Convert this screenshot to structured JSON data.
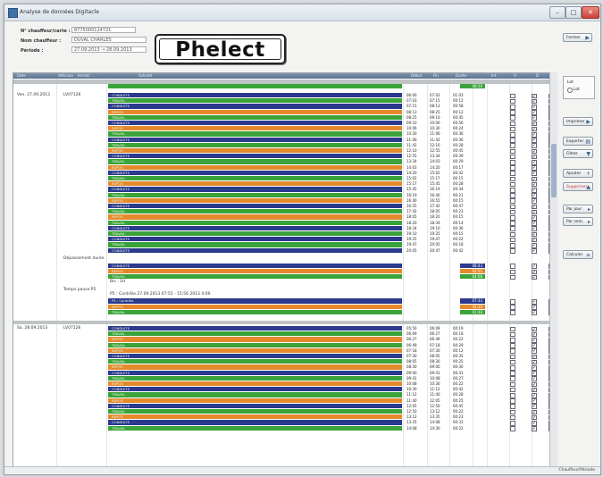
{
  "window": {
    "title": "Analyse de données Digitacle"
  },
  "header": {
    "fields": [
      {
        "label": "N° chauffeur/carte :",
        "value": "8775000124721"
      },
      {
        "label": "Nom chauffeur :",
        "value": "DUVAL CHARLES"
      },
      {
        "label": "Période :",
        "value": "27.09.2013  →  28.09.2013"
      }
    ],
    "logo_text": "Phelect",
    "top_right_button": "Fermer"
  },
  "grid": {
    "columns": [
      "Date",
      "Véhicule",
      "Immat.",
      "Activité",
      "Début",
      "Fin",
      "Durée",
      "Inf.",
      "V",
      "D"
    ],
    "summary_value": "08:50",
    "groups": [
      {
        "date": "Ven. 27.09.2013",
        "vehicle": "LV07126"
      },
      {
        "date": "Sa. 28.09.2013",
        "vehicle": "LV07126"
      }
    ],
    "section_labels": {
      "repos": "Dépassement durée",
      "pause": "Temps pause P5",
      "repos_total": "Bis : 1H",
      "comment": "P5 : Contrôle 27.09.2013 07:55 - 15:56 2013 4:00"
    },
    "rows_a": [
      {
        "act": "CONDUITE",
        "c": "navy",
        "s": "06:00",
        "e": "07:03",
        "d": "01:03"
      },
      {
        "act": "TRAVAIL",
        "c": "green",
        "s": "07:03",
        "e": "07:15",
        "d": "00:12"
      },
      {
        "act": "CONDUITE",
        "c": "navy",
        "s": "07:15",
        "e": "08:13",
        "d": "00:58"
      },
      {
        "act": "REPOS",
        "c": "orange",
        "s": "08:13",
        "e": "08:25",
        "d": "00:12"
      },
      {
        "act": "TRAVAIL",
        "c": "green",
        "s": "08:25",
        "e": "09:10",
        "d": "00:45"
      },
      {
        "act": "CONDUITE",
        "c": "navy",
        "s": "09:10",
        "e": "10:06",
        "d": "00:56"
      },
      {
        "act": "REPOS",
        "c": "orange",
        "s": "10:06",
        "e": "10:30",
        "d": "00:24"
      },
      {
        "act": "TRAVAIL",
        "c": "green",
        "s": "10:30",
        "e": "11:06",
        "d": "00:36"
      },
      {
        "act": "CONDUITE",
        "c": "navy",
        "s": "11:06",
        "e": "11:42",
        "d": "00:36"
      },
      {
        "act": "TRAVAIL",
        "c": "green",
        "s": "11:42",
        "e": "12:10",
        "d": "00:28"
      },
      {
        "act": "REPOS",
        "c": "orange",
        "s": "12:10",
        "e": "12:55",
        "d": "00:45"
      },
      {
        "act": "CONDUITE",
        "c": "navy",
        "s": "12:55",
        "e": "13:34",
        "d": "00:39"
      },
      {
        "act": "TRAVAIL",
        "c": "green",
        "s": "13:34",
        "e": "14:03",
        "d": "00:29"
      },
      {
        "act": "REPOS",
        "c": "orange",
        "s": "14:03",
        "e": "14:20",
        "d": "00:17"
      },
      {
        "act": "CONDUITE",
        "c": "navy",
        "s": "14:20",
        "e": "15:02",
        "d": "00:42"
      },
      {
        "act": "TRAVAIL",
        "c": "green",
        "s": "15:02",
        "e": "15:17",
        "d": "00:15"
      },
      {
        "act": "REPOS",
        "c": "orange",
        "s": "15:17",
        "e": "15:45",
        "d": "00:28"
      },
      {
        "act": "CONDUITE",
        "c": "navy",
        "s": "15:45",
        "e": "16:19",
        "d": "00:34"
      },
      {
        "act": "TRAVAIL",
        "c": "green",
        "s": "16:19",
        "e": "16:40",
        "d": "00:21"
      },
      {
        "act": "REPOS",
        "c": "orange",
        "s": "16:40",
        "e": "16:55",
        "d": "00:15"
      },
      {
        "act": "CONDUITE",
        "c": "navy",
        "s": "16:55",
        "e": "17:42",
        "d": "00:47"
      },
      {
        "act": "TRAVAIL",
        "c": "green",
        "s": "17:42",
        "e": "18:05",
        "d": "00:23"
      },
      {
        "act": "REPOS",
        "c": "orange",
        "s": "18:05",
        "e": "18:20",
        "d": "00:15"
      },
      {
        "act": "TRAVAIL",
        "c": "green",
        "s": "18:20",
        "e": "18:34",
        "d": "00:14"
      },
      {
        "act": "CONDUITE",
        "c": "navy",
        "s": "18:34",
        "e": "19:10",
        "d": "00:36"
      },
      {
        "act": "TRAVAIL",
        "c": "green",
        "s": "19:10",
        "e": "19:25",
        "d": "00:15"
      },
      {
        "act": "CONDUITE",
        "c": "navy",
        "s": "19:25",
        "e": "19:47",
        "d": "00:22"
      },
      {
        "act": "TRAVAIL",
        "c": "green",
        "s": "19:47",
        "e": "20:05",
        "d": "00:18"
      },
      {
        "act": "CONDUITE",
        "c": "navy",
        "s": "20:05",
        "e": "20:47",
        "d": "00:42"
      }
    ],
    "rows_b": [
      {
        "act": "CONDUITE",
        "c": "navy",
        "d": "08:43"
      },
      {
        "act": "REPOS",
        "c": "orange",
        "d": "02:51"
      },
      {
        "act": "TRAVAIL",
        "c": "green",
        "d": "04:08"
      }
    ],
    "rows_c": [
      {
        "act": "P5 : Contrôle",
        "c": "navy",
        "d": "07:33"
      },
      {
        "act": "REPOS",
        "c": "orange",
        "d": "02:26"
      },
      {
        "act": "TRAVAIL",
        "c": "green",
        "d": "01:48"
      }
    ],
    "rows_d": [
      {
        "act": "CONDUITE",
        "c": "navy",
        "s": "05:50",
        "e": "06:09",
        "d": "00:19"
      },
      {
        "act": "TRAVAIL",
        "c": "green",
        "s": "06:09",
        "e": "06:27",
        "d": "00:18"
      },
      {
        "act": "REPOS",
        "c": "orange",
        "s": "06:27",
        "e": "06:49",
        "d": "00:22"
      },
      {
        "act": "TRAVAIL",
        "c": "green",
        "s": "06:49",
        "e": "07:18",
        "d": "00:29"
      },
      {
        "act": "REPOS",
        "c": "orange",
        "s": "07:18",
        "e": "07:30",
        "d": "00:12"
      },
      {
        "act": "CONDUITE",
        "c": "navy",
        "s": "07:30",
        "e": "08:05",
        "d": "00:35"
      },
      {
        "act": "TRAVAIL",
        "c": "green",
        "s": "08:05",
        "e": "08:30",
        "d": "00:25"
      },
      {
        "act": "REPOS",
        "c": "orange",
        "s": "08:30",
        "e": "09:00",
        "d": "00:30"
      },
      {
        "act": "CONDUITE",
        "c": "navy",
        "s": "09:00",
        "e": "09:41",
        "d": "00:41"
      },
      {
        "act": "TRAVAIL",
        "c": "green",
        "s": "09:41",
        "e": "10:08",
        "d": "00:27"
      },
      {
        "act": "REPOS",
        "c": "orange",
        "s": "10:08",
        "e": "10:30",
        "d": "00:22"
      },
      {
        "act": "CONDUITE",
        "c": "navy",
        "s": "10:30",
        "e": "11:12",
        "d": "00:42"
      },
      {
        "act": "TRAVAIL",
        "c": "green",
        "s": "11:12",
        "e": "11:40",
        "d": "00:28"
      },
      {
        "act": "REPOS",
        "c": "orange",
        "s": "11:40",
        "e": "12:05",
        "d": "00:25"
      },
      {
        "act": "CONDUITE",
        "c": "navy",
        "s": "12:05",
        "e": "12:50",
        "d": "00:45"
      },
      {
        "act": "TRAVAIL",
        "c": "green",
        "s": "12:50",
        "e": "13:12",
        "d": "00:22"
      },
      {
        "act": "REPOS",
        "c": "orange",
        "s": "13:12",
        "e": "13:35",
        "d": "00:23"
      },
      {
        "act": "CONDUITE",
        "c": "navy",
        "s": "13:35",
        "e": "14:08",
        "d": "00:33"
      },
      {
        "act": "TRAVAIL",
        "c": "green",
        "s": "14:08",
        "e": "14:30",
        "d": "00:22"
      }
    ],
    "colors": {
      "navy": "#2b3a8c",
      "green": "#3aa33a",
      "orange": "#e48a2c",
      "gray": "#a7a7a7"
    }
  },
  "sidebar": {
    "option_label": "Lot",
    "option_value": "Lot",
    "buttons": [
      {
        "label": "Imprimer",
        "icon": "▶"
      },
      {
        "label": "Exporter",
        "icon": "▤"
      },
      {
        "label": "Filtrer",
        "icon": "▼"
      },
      {
        "label": "Ajouter",
        "icon": "+"
      },
      {
        "label": "Supprimer",
        "icon": "▲"
      },
      {
        "label": "Par jour",
        "icon": "▸"
      },
      {
        "label": "Par sem.",
        "icon": "▸"
      },
      {
        "label": "Calculer",
        "icon": "≡"
      }
    ]
  },
  "status": {
    "text": "Chauffeur/Période"
  }
}
